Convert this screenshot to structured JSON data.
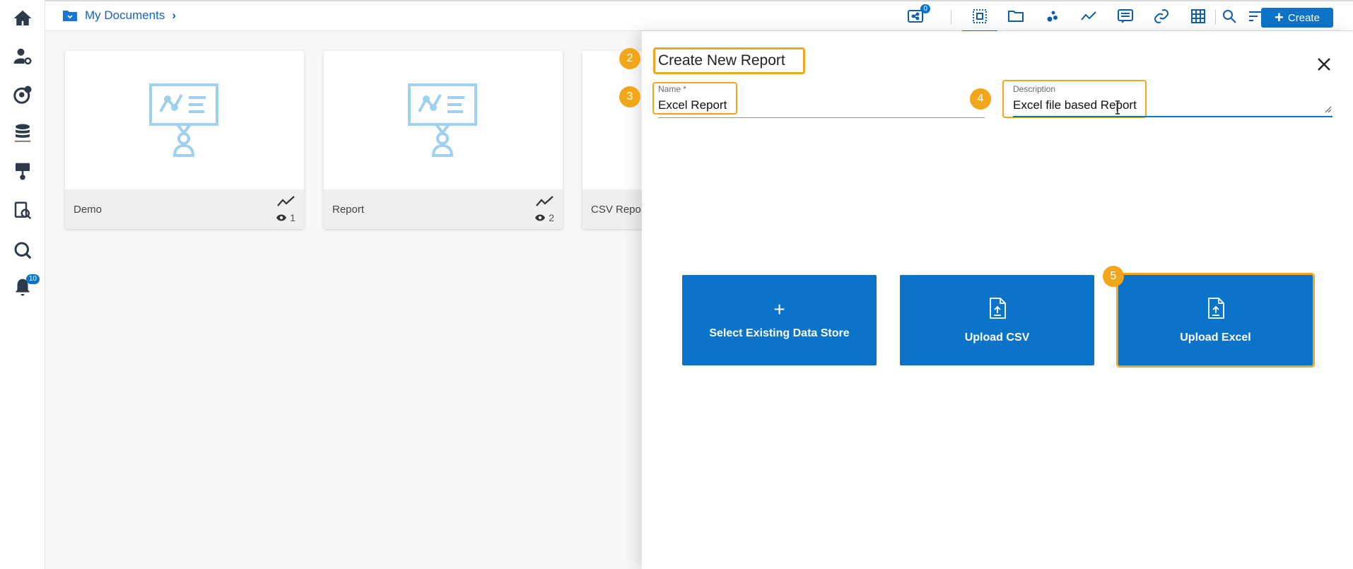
{
  "breadcrumb": {
    "label": "My Documents"
  },
  "toolbar": {
    "share_count": "0",
    "create_label": "Create"
  },
  "rail": {
    "notification_count": "10"
  },
  "cards": [
    {
      "name": "Demo",
      "views": "1"
    },
    {
      "name": "Report",
      "views": "2"
    },
    {
      "name": "CSV Repo"
    }
  ],
  "panel": {
    "title": "Create New Report",
    "name_label": "Name *",
    "name_value": "Excel Report",
    "description_label": "Description",
    "description_value": "Excel file based Report",
    "actions": [
      {
        "label": "Select Existing Data Store",
        "icon": "plus-icon"
      },
      {
        "label": "Upload CSV",
        "icon": "file-upload-icon"
      },
      {
        "label": "Upload Excel",
        "icon": "file-upload-icon"
      }
    ],
    "annotations": [
      "2",
      "3",
      "4",
      "5"
    ]
  },
  "colors": {
    "accent": "#0b74c9",
    "highlight": "#f2a71b"
  }
}
